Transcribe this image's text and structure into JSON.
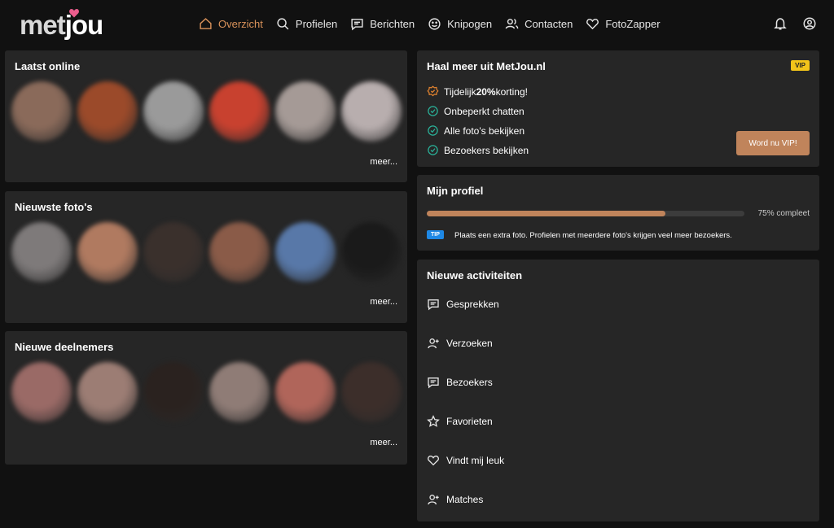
{
  "header": {
    "logo": {
      "part1": "met",
      "part2": "jou"
    },
    "nav": [
      {
        "label": "Overzicht",
        "icon": "home-icon",
        "active": true
      },
      {
        "label": "Profielen",
        "icon": "search-icon"
      },
      {
        "label": "Berichten",
        "icon": "message-icon"
      },
      {
        "label": "Knipogen",
        "icon": "smiley-icon"
      },
      {
        "label": "Contacten",
        "icon": "contacts-icon"
      },
      {
        "label": "FotoZapper",
        "icon": "heart-icon"
      }
    ],
    "icons": [
      "bell-icon",
      "user-circle-icon"
    ]
  },
  "colors": {
    "accent": "#d9925a",
    "button": "#c0845b",
    "card": "#262626",
    "background": "#111111",
    "vip": "#f2c41a",
    "tip": "#1e88e5",
    "logo_heart": "#ec5d8d"
  },
  "sections": {
    "laatst_online": {
      "title": "Laatst online",
      "more": "meer...",
      "avatar_colors": [
        "#8a6a5a",
        "#9b4a2a",
        "#9a9a9a",
        "#c8412f",
        "#a59a96",
        "#b8aeae"
      ]
    },
    "nieuwste_fotos": {
      "title": "Nieuwste foto's",
      "more": "meer...",
      "avatar_colors": [
        "#7e7a7a",
        "#b07a60",
        "#3a302c",
        "#8a5b48",
        "#5878a8",
        "#1a1a1a"
      ]
    },
    "nieuwe_deelnemers": {
      "title": "Nieuwe deelnemers",
      "more": "meer...",
      "avatar_colors": [
        "#9a6a66",
        "#9c7d74",
        "#2a221f",
        "#8f7c76",
        "#b0655a",
        "#3c2e2a"
      ]
    }
  },
  "vip": {
    "title": "Haal meer uit MetJou.nl",
    "badge": "VIP",
    "benefits": [
      {
        "prefix": "Tijdelijk ",
        "bold": "20%",
        "suffix": " korting!",
        "icon": "discount-badge-icon"
      },
      {
        "prefix": "Onbeperkt chatten",
        "bold": "",
        "suffix": "",
        "icon": "check-circle-icon"
      },
      {
        "prefix": "Alle foto's bekijken",
        "bold": "",
        "suffix": "",
        "icon": "check-circle-icon"
      },
      {
        "prefix": "Bezoekers bekijken",
        "bold": "",
        "suffix": "",
        "icon": "check-circle-icon"
      }
    ],
    "button": "Word nu VIP!"
  },
  "profile": {
    "title": "Mijn profiel",
    "progress": 0.75,
    "progress_label": "75% compleet",
    "tip_badge": "TIP",
    "tip_text": "Plaats een extra foto. Profielen met meerdere foto's krijgen veel meer bezoekers."
  },
  "activities": {
    "title": "Nieuwe activiteiten",
    "items": [
      {
        "label": "Gesprekken",
        "icon": "chat-icon"
      },
      {
        "label": "Verzoeken",
        "icon": "user-plus-icon"
      },
      {
        "label": "Bezoekers",
        "icon": "chat-icon"
      },
      {
        "label": "Favorieten",
        "icon": "star-icon"
      },
      {
        "label": "Vindt mij leuk",
        "icon": "heart-icon"
      },
      {
        "label": "Matches",
        "icon": "user-plus-icon"
      }
    ]
  }
}
